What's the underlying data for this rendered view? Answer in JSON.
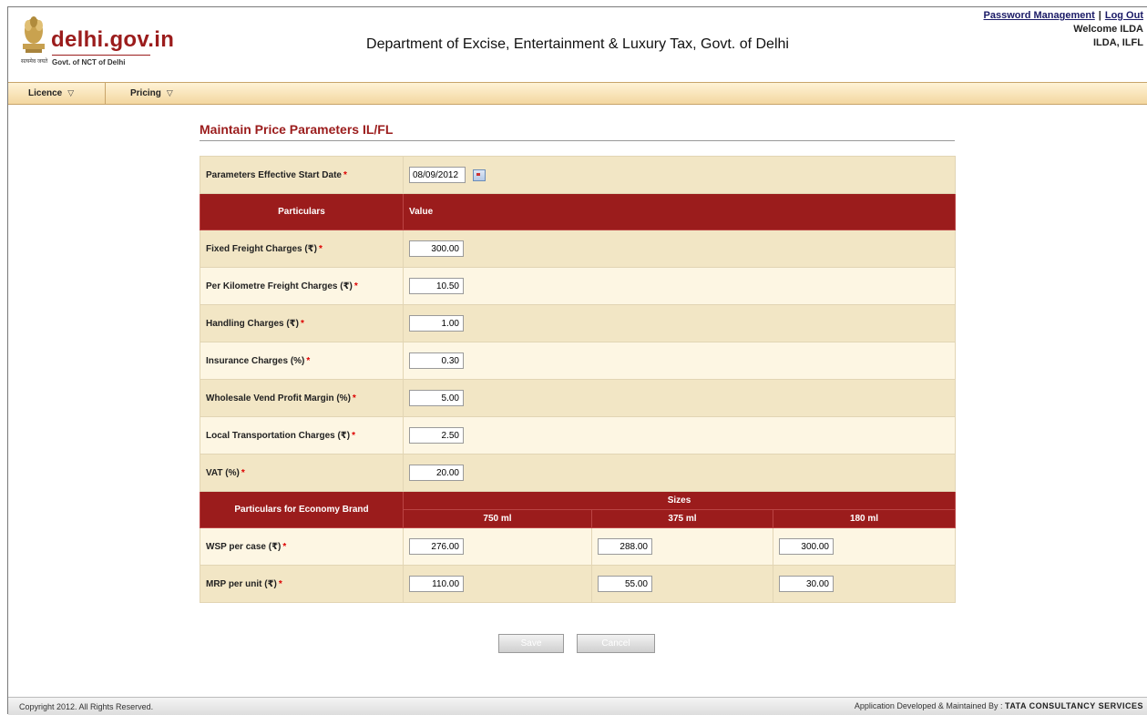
{
  "header": {
    "logo_text": "delhi.gov.in",
    "logo_hindi": "सत्यमेव जयते",
    "logo_sub": "Govt. of NCT of Delhi",
    "title": "Department of Excise, Entertainment & Luxury Tax, Govt. of Delhi",
    "links": {
      "password": "Password Management",
      "separator": "|",
      "logout": "Log Out"
    },
    "welcome": "Welcome ILDA",
    "user": "ILDA, ILFL"
  },
  "nav": {
    "items": [
      {
        "label": "Licence",
        "icon": "triangle-down-icon"
      },
      {
        "label": "Pricing",
        "icon": "triangle-down-icon"
      }
    ]
  },
  "page": {
    "heading": "Maintain Price Parameters IL/FL",
    "start_date_label": "Parameters Effective Start Date",
    "start_date_value": "08/09/2012",
    "calendar_icon": "calendar-icon",
    "required_marker": "*",
    "col_particulars": "Particulars",
    "col_value": "Value",
    "params": [
      {
        "label": "Fixed Freight Charges (₹)",
        "value": "300.00"
      },
      {
        "label": "Per Kilometre Freight Charges (₹)",
        "value": "10.50"
      },
      {
        "label": "Handling Charges (₹)",
        "value": "1.00"
      },
      {
        "label": "Insurance Charges (%)",
        "value": "0.30"
      },
      {
        "label": "Wholesale Vend Profit Margin (%)",
        "value": "5.00"
      },
      {
        "label": "Local Transportation Charges (₹)",
        "value": "2.50"
      },
      {
        "label": "VAT (%)",
        "value": "20.00"
      }
    ],
    "economy_header": "Particulars for Economy Brand",
    "sizes_header": "Sizes",
    "sizes": [
      "750 ml",
      "375 ml",
      "180 ml"
    ],
    "economy_rows": [
      {
        "label": "WSP per case (₹)",
        "values": [
          "276.00",
          "288.00",
          "300.00"
        ]
      },
      {
        "label": "MRP per unit (₹)",
        "values": [
          "110.00",
          "55.00",
          "30.00"
        ]
      }
    ],
    "buttons": {
      "save": "Save",
      "cancel": "Cancel"
    }
  },
  "footer": {
    "copyright": "Copyright 2012. All Rights Reserved.",
    "developed_by": "Application Developed & Maintained By :",
    "vendor": "TATA CONSULTANCY SERVICES"
  },
  "colors": {
    "brand": "#9b1c1c",
    "row_odd": "#f2e6c5",
    "row_even": "#fdf6e3"
  }
}
